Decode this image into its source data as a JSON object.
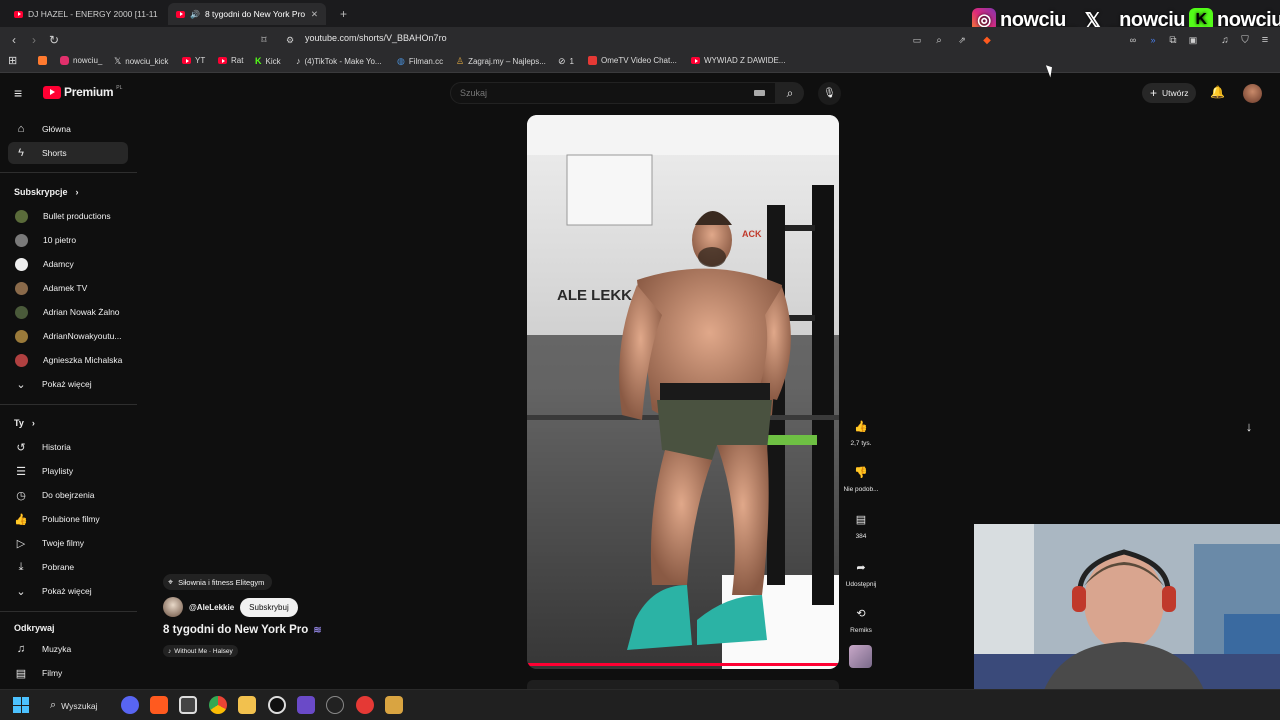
{
  "browser": {
    "tabs": [
      {
        "title": "DJ HAZEL - ENERGY 2000 [11-11"
      },
      {
        "title": "8 tygodni do New York Pro",
        "active": true
      }
    ],
    "new_tab": "+",
    "url": "youtube.com/shorts/V_BBAHOn7ro",
    "bookmarks": [
      {
        "label": "",
        "icon": "brave-folder-icon",
        "color": "#ff7a2f"
      },
      {
        "label": "nowciu_",
        "icon": "instagram-icon",
        "color": "#e1306c"
      },
      {
        "label": "nowciu_kick",
        "icon": "x-icon",
        "color": "#000000"
      },
      {
        "label": "YT",
        "icon": "youtube-icon",
        "color": "#ff0033"
      },
      {
        "label": "Rat",
        "icon": "youtube-icon",
        "color": "#ff0033"
      },
      {
        "label": "Kick",
        "icon": "kick-icon",
        "color": "#53fc18"
      },
      {
        "label": "(4)TikTok - Make Yo...",
        "icon": "tiktok-icon",
        "color": "#111111"
      },
      {
        "label": "Filman.cc",
        "icon": "globe-icon",
        "color": "#4a90d9"
      },
      {
        "label": "Zagraj.my – Najleps...",
        "icon": "person-icon",
        "color": "#d9a441"
      },
      {
        "label": "1",
        "icon": "settings-icon",
        "color": "#888888"
      },
      {
        "label": "OmeTV Video Chat...",
        "icon": "ometv-icon",
        "color": "#e53935"
      },
      {
        "label": "WYWIAD Z DAWIDE...",
        "icon": "youtube-icon",
        "color": "#ff0033"
      }
    ]
  },
  "overlay": {
    "instagram": "nowciu_",
    "x": "_nowciu",
    "kick": "nowciu"
  },
  "youtube": {
    "logo": "Premium",
    "logo_sup": "PL",
    "search_placeholder": "Szukaj",
    "create_label": "Utwórz",
    "sidebar": {
      "main": [
        {
          "label": "Główna",
          "icon": "home-icon"
        },
        {
          "label": "Shorts",
          "icon": "shorts-icon",
          "active": true
        }
      ],
      "subs_header": "Subskrypcje",
      "subs": [
        {
          "label": "Bullet productions",
          "color": "#5a6b3a"
        },
        {
          "label": "10 pietro",
          "color": "#7a7a7a"
        },
        {
          "label": "Adamcy",
          "color": "#eeeeee"
        },
        {
          "label": "Adamek TV",
          "color": "#8a6a4a"
        },
        {
          "label": "Adrian Nowak Żalno",
          "color": "#4a5a3a"
        },
        {
          "label": "AdrianNowakyoutu...",
          "color": "#9a7a3a"
        },
        {
          "label": "Agnieszka Michalska",
          "color": "#b04040"
        }
      ],
      "show_more": "Pokaż więcej",
      "you_header": "Ty",
      "you": [
        {
          "label": "Historia",
          "icon": "history-icon"
        },
        {
          "label": "Playlisty",
          "icon": "playlist-icon"
        },
        {
          "label": "Do obejrzenia",
          "icon": "watch-later-icon"
        },
        {
          "label": "Polubione filmy",
          "icon": "like-icon"
        },
        {
          "label": "Twoje filmy",
          "icon": "your-videos-icon"
        },
        {
          "label": "Pobrane",
          "icon": "download-icon"
        },
        {
          "label": "Pokaż więcej",
          "icon": "chevron-down-icon"
        }
      ],
      "explore_header": "Odkrywaj",
      "explore": [
        {
          "label": "Muzyka",
          "icon": "music-icon"
        },
        {
          "label": "Filmy",
          "icon": "film-icon"
        }
      ]
    },
    "short": {
      "location": "Siłownia i fitness Elitegym",
      "channel": "@AleLekkie",
      "subscribe": "Subskrybuj",
      "title": "8 tygodni do New York Pro",
      "music": "Without Me · Halsey",
      "wall_text": "ALE LEKK",
      "rack_text": "ACK"
    },
    "actions": [
      {
        "label": "2,7 tys.",
        "icon": "like-icon"
      },
      {
        "label": "Nie podob...",
        "icon": "dislike-icon"
      },
      {
        "label": "384",
        "icon": "comment-icon"
      },
      {
        "label": "Udostępnij",
        "icon": "share-icon"
      },
      {
        "label": "Remiks",
        "icon": "remix-icon"
      }
    ]
  },
  "taskbar": {
    "search": "Wyszukaj"
  }
}
